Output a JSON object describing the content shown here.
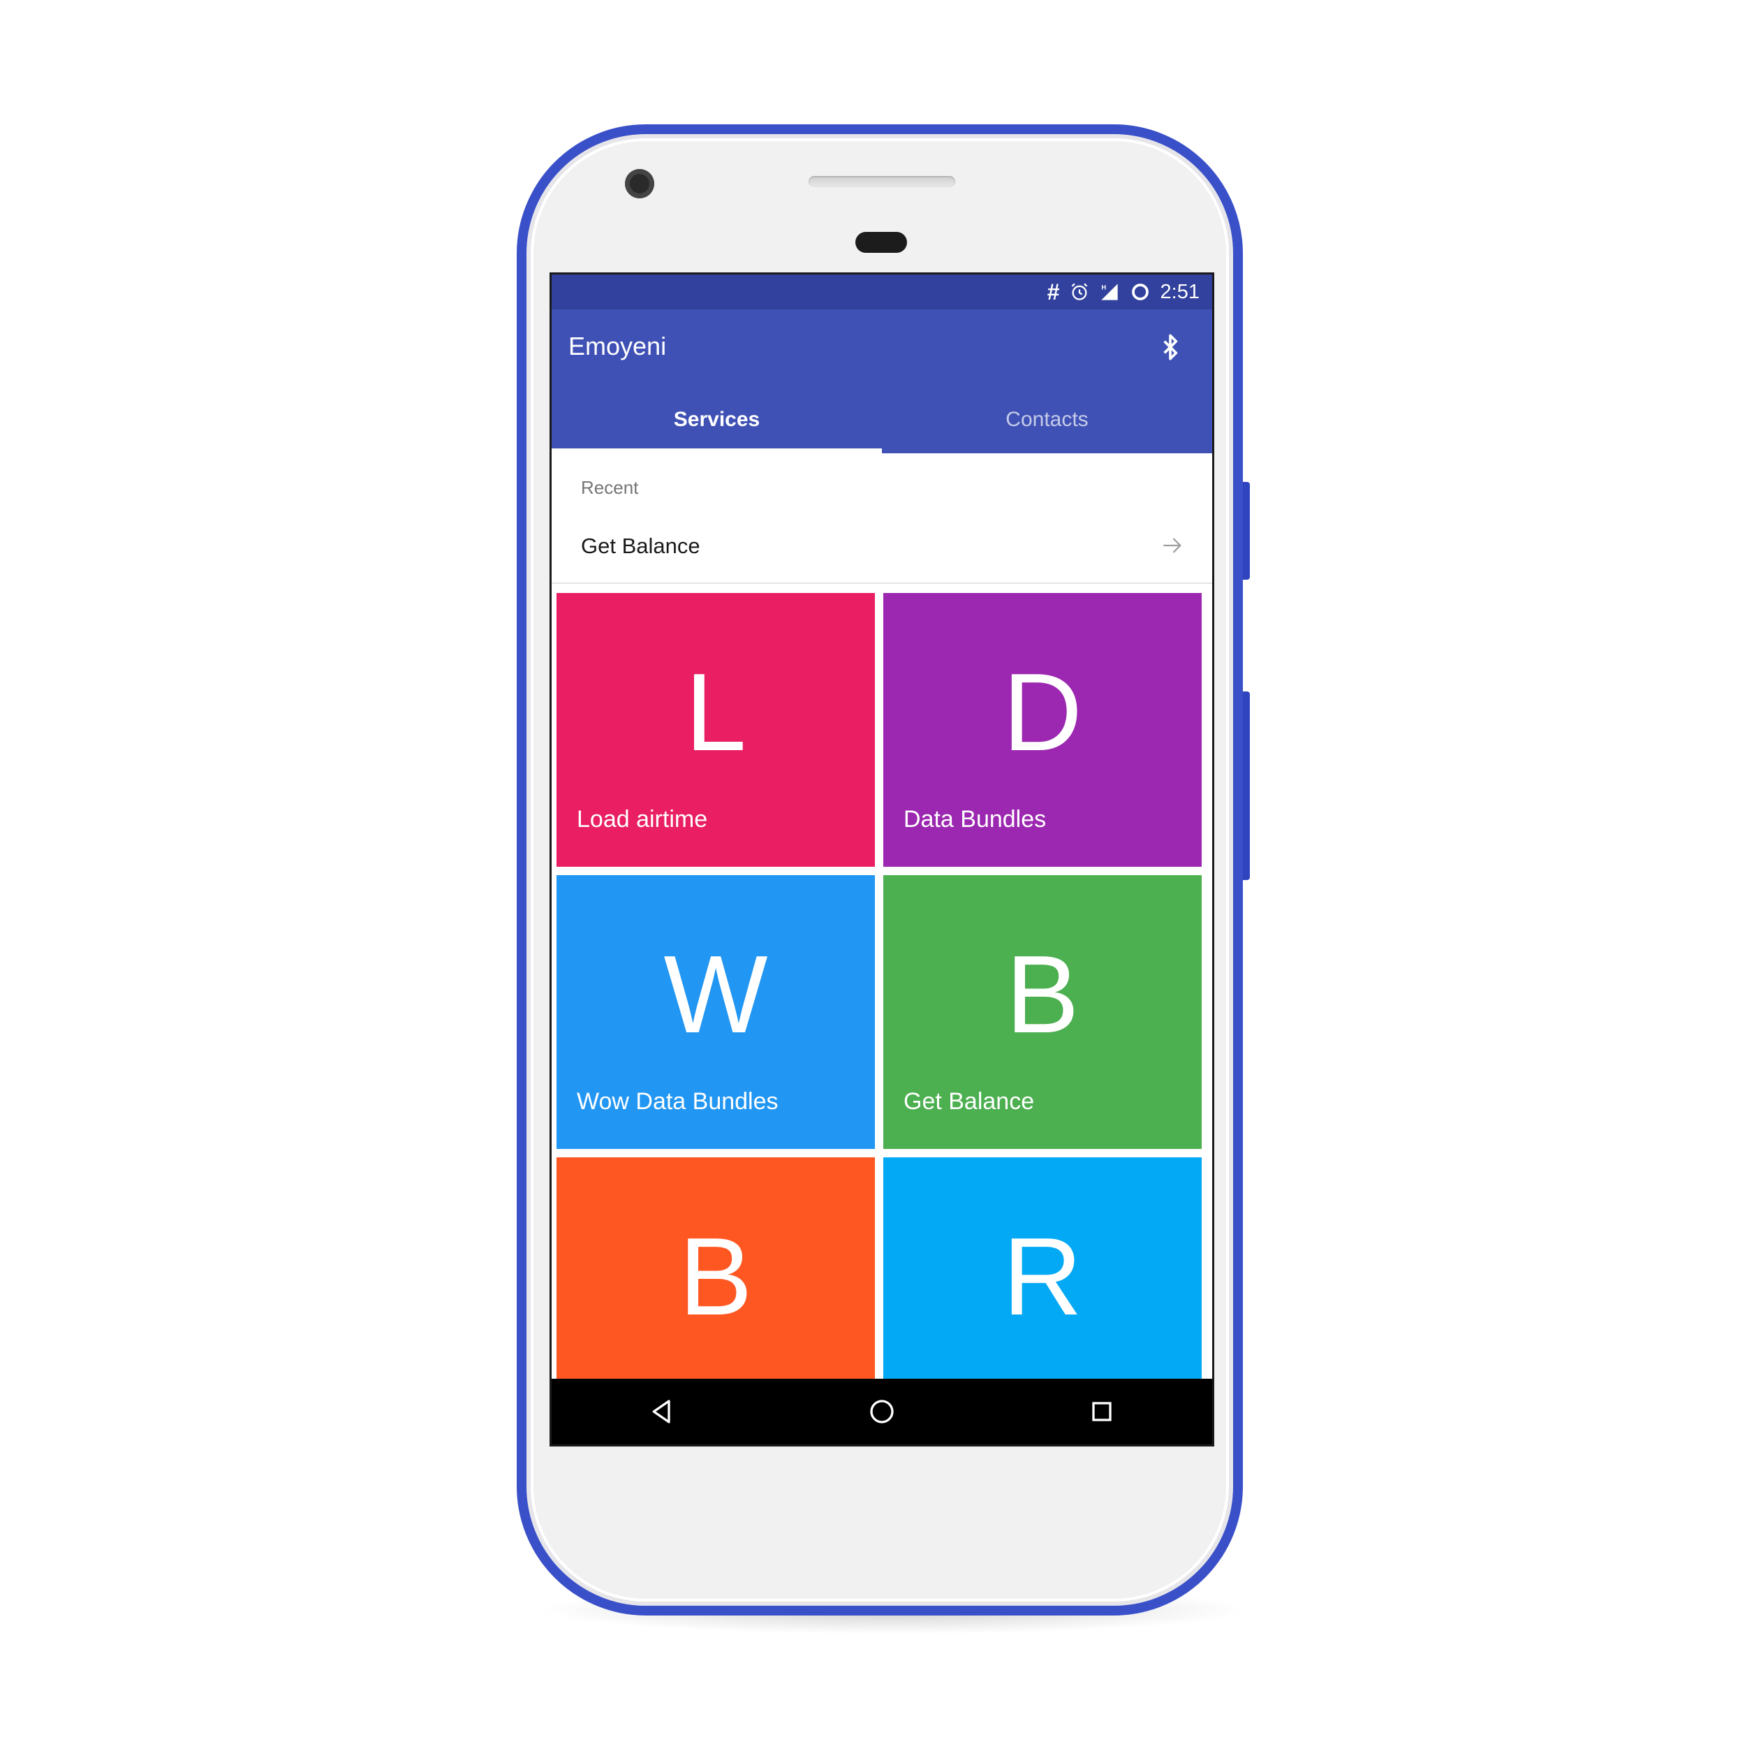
{
  "status_bar": {
    "hash_icon": "#",
    "time": "2:51",
    "icons": [
      "alarm-icon",
      "signal-icon",
      "sync-icon"
    ]
  },
  "app": {
    "title": "Emoyeni",
    "bluetooth_icon": "bluetooth-icon"
  },
  "tabs": [
    {
      "label": "Services",
      "active": true
    },
    {
      "label": "Contacts",
      "active": false
    }
  ],
  "recent": {
    "header": "Recent",
    "items": [
      {
        "label": "Get Balance"
      }
    ]
  },
  "services": [
    {
      "letter": "L",
      "label": "Load airtime",
      "color": "#e91e63"
    },
    {
      "letter": "D",
      "label": "Data Bundles",
      "color": "#9c27b0"
    },
    {
      "letter": "W",
      "label": "Wow Data Bundles",
      "color": "#2196f3"
    },
    {
      "letter": "B",
      "label": "Get Balance",
      "color": "#4caf50"
    },
    {
      "letter": "B",
      "label": "",
      "color": "#ff5722"
    },
    {
      "letter": "R",
      "label": "",
      "color": "#03a9f4"
    }
  ],
  "colors": {
    "primary": "#3f51b5",
    "primary_dark": "#31419d",
    "phone_frame": "#3a50c8"
  }
}
